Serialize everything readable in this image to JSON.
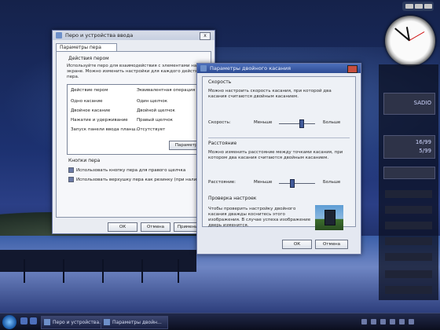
{
  "pen_window": {
    "title": "Перо и устройства ввода",
    "close_label": "x",
    "tab_label": "Параметры пера",
    "section_actions": "Действия пером",
    "actions_desc": "Используйте перо для взаимодействия с элементами на экране. Можно изменить настройки для каждого действия пера.",
    "table_headers": [
      "Действие пером",
      "Эквивалентная операция"
    ],
    "rows": [
      {
        "action": "Одно касание",
        "equivalent": "Один щелчок"
      },
      {
        "action": "Двойное касание",
        "equivalent": "Двойной щелчок"
      },
      {
        "action": "Нажатие и удерживание",
        "equivalent": "Правый щелчок"
      },
      {
        "action": "Запуск панели ввода планш...",
        "equivalent": "Отсутствует"
      }
    ],
    "params_button": "Параметры...",
    "section_buttons": "Кнопки пера",
    "checkbox1": "Использовать кнопку пера для правого щелчка",
    "checkbox2": "Использовать верхушку пера как резинку (при наличии)",
    "ok_button": "ОК",
    "cancel_button": "Отмена",
    "apply_button": "Применить"
  },
  "double_tap_window": {
    "title": "Параметры двойного касания",
    "section_speed": "Скорость",
    "speed_desc": "Можно настроить скорость касания, при которой два касания считаются двойным касанием.",
    "speed_label": "Скорость:",
    "speed_min": "Меньше",
    "speed_max": "Больше",
    "speed_value": 0.6,
    "section_distance": "Расстояние",
    "distance_desc": "Можно изменить расстояние между точками касания, при котором два касания считаются двойным касанием.",
    "distance_label": "Расстояние:",
    "distance_min": "Меньше",
    "distance_max": "Больше",
    "distance_value": 0.35,
    "section_test": "Проверка настроек",
    "test_desc": "Чтобы проверить настройку двойного касания дважды коснитесь этого изображения. В случае успеха изображение дверь изменится.",
    "ok_button": "ОК",
    "cancel_button": "Отмена"
  },
  "sidebar": {
    "clock_time": "10:52",
    "cpu_label": "SADIO",
    "meter1": "16/99",
    "meter2": "5/99"
  },
  "taskbar": {
    "task1": "Перо и устройства...",
    "task2": "Параметры двойн..."
  }
}
